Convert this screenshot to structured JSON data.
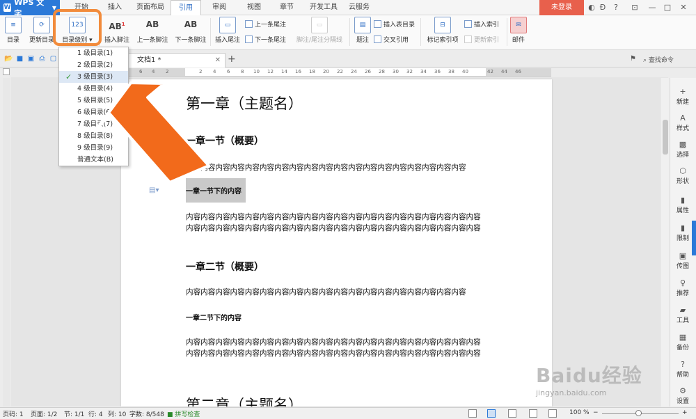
{
  "app": {
    "name": "WPS 文字",
    "login": "未登录"
  },
  "menu_tabs": [
    {
      "label": "开始"
    },
    {
      "label": "插入"
    },
    {
      "label": "页面布局"
    },
    {
      "label": "引用"
    },
    {
      "label": "审阅"
    },
    {
      "label": "视图"
    },
    {
      "label": "章节"
    },
    {
      "label": "开发工具"
    },
    {
      "label": "云服务"
    }
  ],
  "ribbon": {
    "toc": "目录",
    "update_toc": "更新目录",
    "toc_level": "目录级别",
    "insert_footnote": "插入脚注",
    "prev_footnote": "上一条脚注",
    "next_footnote": "下一条脚注",
    "insert_endnote": "插入尾注",
    "prev_endnote": "上一条尾注",
    "next_endnote": "下一条尾注",
    "footnote_separator": "脚注/尾注分隔线",
    "caption": "题注",
    "insert_table_of_figures": "插入表目录",
    "cross_reference": "交叉引用",
    "mark_index": "标记索引项",
    "insert_index": "插入索引",
    "update_index": "更新索引",
    "mail": "邮件"
  },
  "doc_tab": {
    "title": "文档1 *"
  },
  "find_command": "查找命令",
  "toc_dropdown": {
    "items": [
      {
        "label": "1 级目录(1)",
        "selected": false
      },
      {
        "label": "2 级目录(2)",
        "selected": false
      },
      {
        "label": "3 级目录(3)",
        "selected": true
      },
      {
        "label": "4 级目录(4)",
        "selected": false
      },
      {
        "label": "5 级目录(5)",
        "selected": false
      },
      {
        "label": "6 级目录(6)",
        "selected": false
      },
      {
        "label": "7 级目录(7)",
        "selected": false
      },
      {
        "label": "8 级目录(8)",
        "selected": false
      },
      {
        "label": "9 级目录(9)",
        "selected": false
      },
      {
        "label": "普通文本(B)",
        "selected": false
      }
    ]
  },
  "ruler_numbers": [
    "6",
    "4",
    "2",
    "2",
    "4",
    "6",
    "8",
    "10",
    "12",
    "14",
    "16",
    "18",
    "20",
    "22",
    "24",
    "26",
    "28",
    "30",
    "32",
    "34",
    "36",
    "38",
    "40",
    "42",
    "44",
    "46"
  ],
  "document": {
    "chapter1": "第一章（主题名）",
    "section1": "一章一节（概要）",
    "content_line1": "内容内容内容内容内容内容内容内容内容内容内容内容内容内容内容内容内容内容内容",
    "subsection1": "一章一节下的内容",
    "content_para2a": "内容内容内容内容内容内容内容内容内容内容内容内容内容内容内容内容内容内容内容内容",
    "content_para2b": "内容内容内容内容内容内容内容内容内容内容内容内容内容内容内容内容内容内容内容内容",
    "section2": "一章二节（概要）",
    "content_line3": "内容内容内容内容内容内容内容内容内容内容内容内容内容内容内容内容内容内容内容",
    "subsection2": "一章二节下的内容",
    "content_para4a": "内容内容内容内容内容内容内容内容内容内容内容内容内容内容内容内容内容内容内容内容",
    "content_para4b": "内容内容内容内容内容内容内容内容内容内容内容内容内容内容内容内容内容内容内容内容",
    "chapter2": "第二章（主题名）"
  },
  "sidebar": {
    "items": [
      {
        "label": "新建",
        "icon": "new-icon"
      },
      {
        "label": "样式",
        "icon": "style-icon"
      },
      {
        "label": "选择",
        "icon": "select-icon"
      },
      {
        "label": "形状",
        "icon": "shape-icon"
      },
      {
        "label": "属性",
        "icon": "property-icon"
      },
      {
        "label": "限制",
        "icon": "restrict-icon"
      },
      {
        "label": "传图",
        "icon": "image-icon"
      },
      {
        "label": "推荐",
        "icon": "recommend-icon"
      },
      {
        "label": "工具",
        "icon": "tool-icon"
      },
      {
        "label": "备份",
        "icon": "backup-icon"
      },
      {
        "label": "帮助",
        "icon": "help-icon"
      },
      {
        "label": "设置",
        "icon": "settings-icon"
      }
    ]
  },
  "status": {
    "page_code": "页码: 1",
    "page": "页面: 1/2",
    "section": "节: 1/1",
    "line": "行: 4",
    "column": "列: 10",
    "word_count": "字数: 8/548",
    "spell_check": "拼写检查",
    "zoom": "100 %"
  },
  "watermark": {
    "logo": "Baidu经验",
    "url": "jingyan.baidu.com"
  },
  "colors": {
    "accent": "#2b79d8",
    "login": "#e8604c",
    "highlight": "#f28b3b",
    "arrow": "#f26a1b"
  }
}
